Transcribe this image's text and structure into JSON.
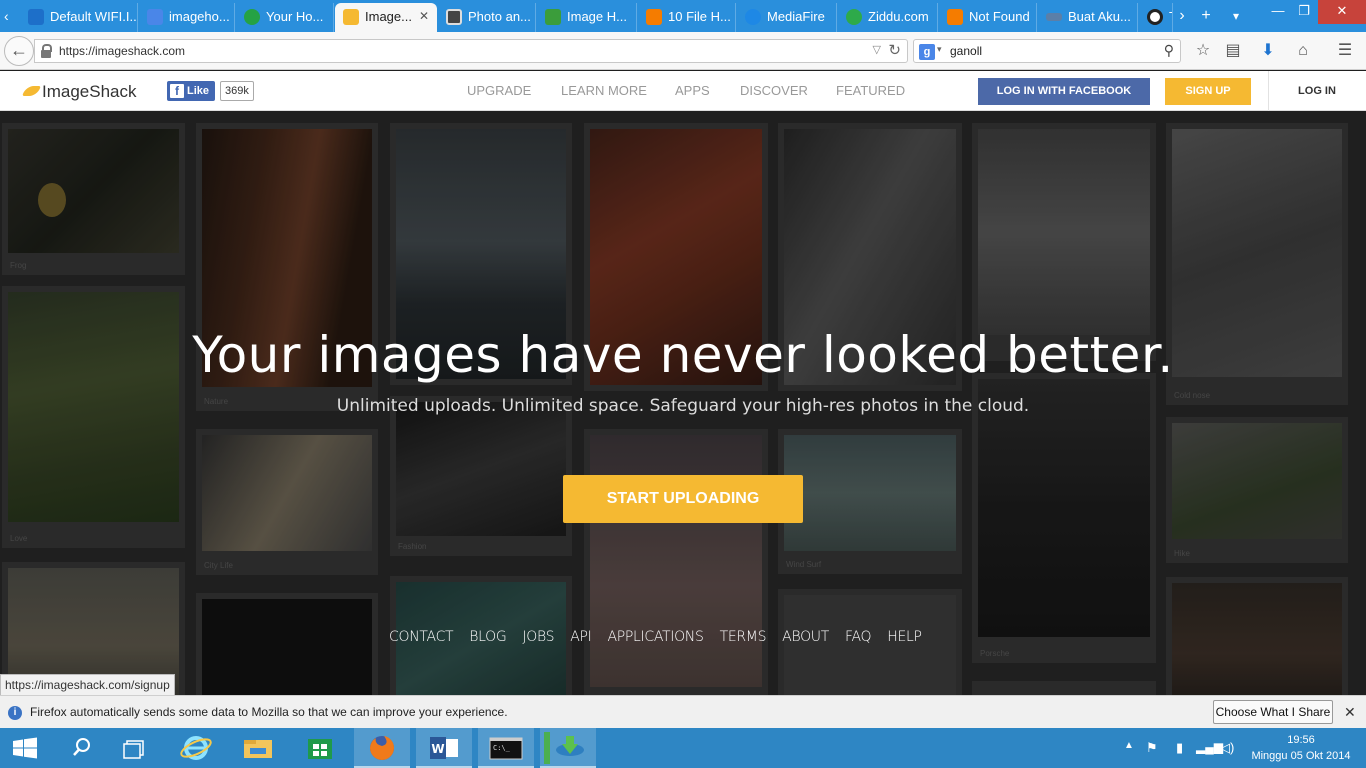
{
  "browser": {
    "tabs": [
      {
        "label": "Default WIFI.I...",
        "icon": "wifi-page-icon",
        "color": "#1d6fc9"
      },
      {
        "label": "imageho...",
        "icon": "google-icon",
        "color": "#4a86e8"
      },
      {
        "label": "Your Ho...",
        "icon": "hosting-icon",
        "color": "#25a244"
      },
      {
        "label": "Image...",
        "icon": "imageshack-icon",
        "color": "#f5b932",
        "active": true
      },
      {
        "label": "Photo an...",
        "icon": "camera-icon",
        "color": "#444444"
      },
      {
        "label": "Image H...",
        "icon": "picture-icon",
        "color": "#3b9d3b"
      },
      {
        "label": "10 File H...",
        "icon": "blogger-icon",
        "color": "#f57c00"
      },
      {
        "label": "MediaFire",
        "icon": "mediafire-icon",
        "color": "#1e88e5"
      },
      {
        "label": "Ziddu.com",
        "icon": "ziddu-icon",
        "color": "#2eaa4a"
      },
      {
        "label": "Not Found",
        "icon": "blogger-icon",
        "color": "#f57c00"
      },
      {
        "label": "Buat Aku...",
        "icon": "key-icon",
        "color": "#5b7fa8"
      },
      {
        "label": "T",
        "icon": "gravatar-icon",
        "color": "#222222"
      }
    ],
    "url": "https://imageshack.com",
    "search_query": "ganoll",
    "status_link": "https://imageshack.com/signup"
  },
  "site": {
    "logo_text": "ImageShack",
    "fb_like_label": "Like",
    "fb_like_count": "369k",
    "menu": [
      "UPGRADE",
      "LEARN MORE",
      "APPS",
      "DISCOVER",
      "FEATURED"
    ],
    "fb_login_label": "LOG IN WITH FACEBOOK",
    "signup_label": "SIGN UP",
    "login_label": "LOG IN",
    "accent_color": "#f5b932",
    "facebook_color": "#4c69a8"
  },
  "hero": {
    "headline": "Your images have never looked better.",
    "subline": "Unlimited uploads. Unlimited space. Safeguard your high-res photos in the cloud.",
    "cta_label": "START UPLOADING",
    "captions": {
      "frog": "Frog",
      "nature": "Nature",
      "love": "Love",
      "city_life": "City Life",
      "fashion": "Fashion",
      "wind_surf": "Wind Surf",
      "cold_nose": "Cold nose",
      "hike": "Hike",
      "porsche": "Porsche"
    },
    "footer_links": [
      "CONTACT",
      "BLOG",
      "JOBS",
      "API",
      "APPLICATIONS",
      "TERMS",
      "ABOUT",
      "FAQ",
      "HELP"
    ]
  },
  "notification": {
    "message": "Firefox automatically sends some data to Mozilla so that we can improve your experience.",
    "button_label": "Choose What I Share"
  },
  "taskbar": {
    "apps": [
      {
        "name": "start-button",
        "icon": "windows-logo-icon"
      },
      {
        "name": "search-button",
        "icon": "search-icon"
      },
      {
        "name": "task-view-button",
        "icon": "task-view-icon"
      },
      {
        "name": "internet-explorer",
        "icon": "ie-icon"
      },
      {
        "name": "file-explorer",
        "icon": "folder-icon"
      },
      {
        "name": "store",
        "icon": "store-icon"
      },
      {
        "name": "firefox",
        "icon": "firefox-icon",
        "open": true
      },
      {
        "name": "word",
        "icon": "word-icon",
        "open": true
      },
      {
        "name": "command-prompt",
        "icon": "cmd-icon",
        "open": true
      },
      {
        "name": "download-manager",
        "icon": "idm-icon",
        "open": true
      }
    ],
    "time": "19:56",
    "date": "Minggu 05 Okt 2014"
  }
}
